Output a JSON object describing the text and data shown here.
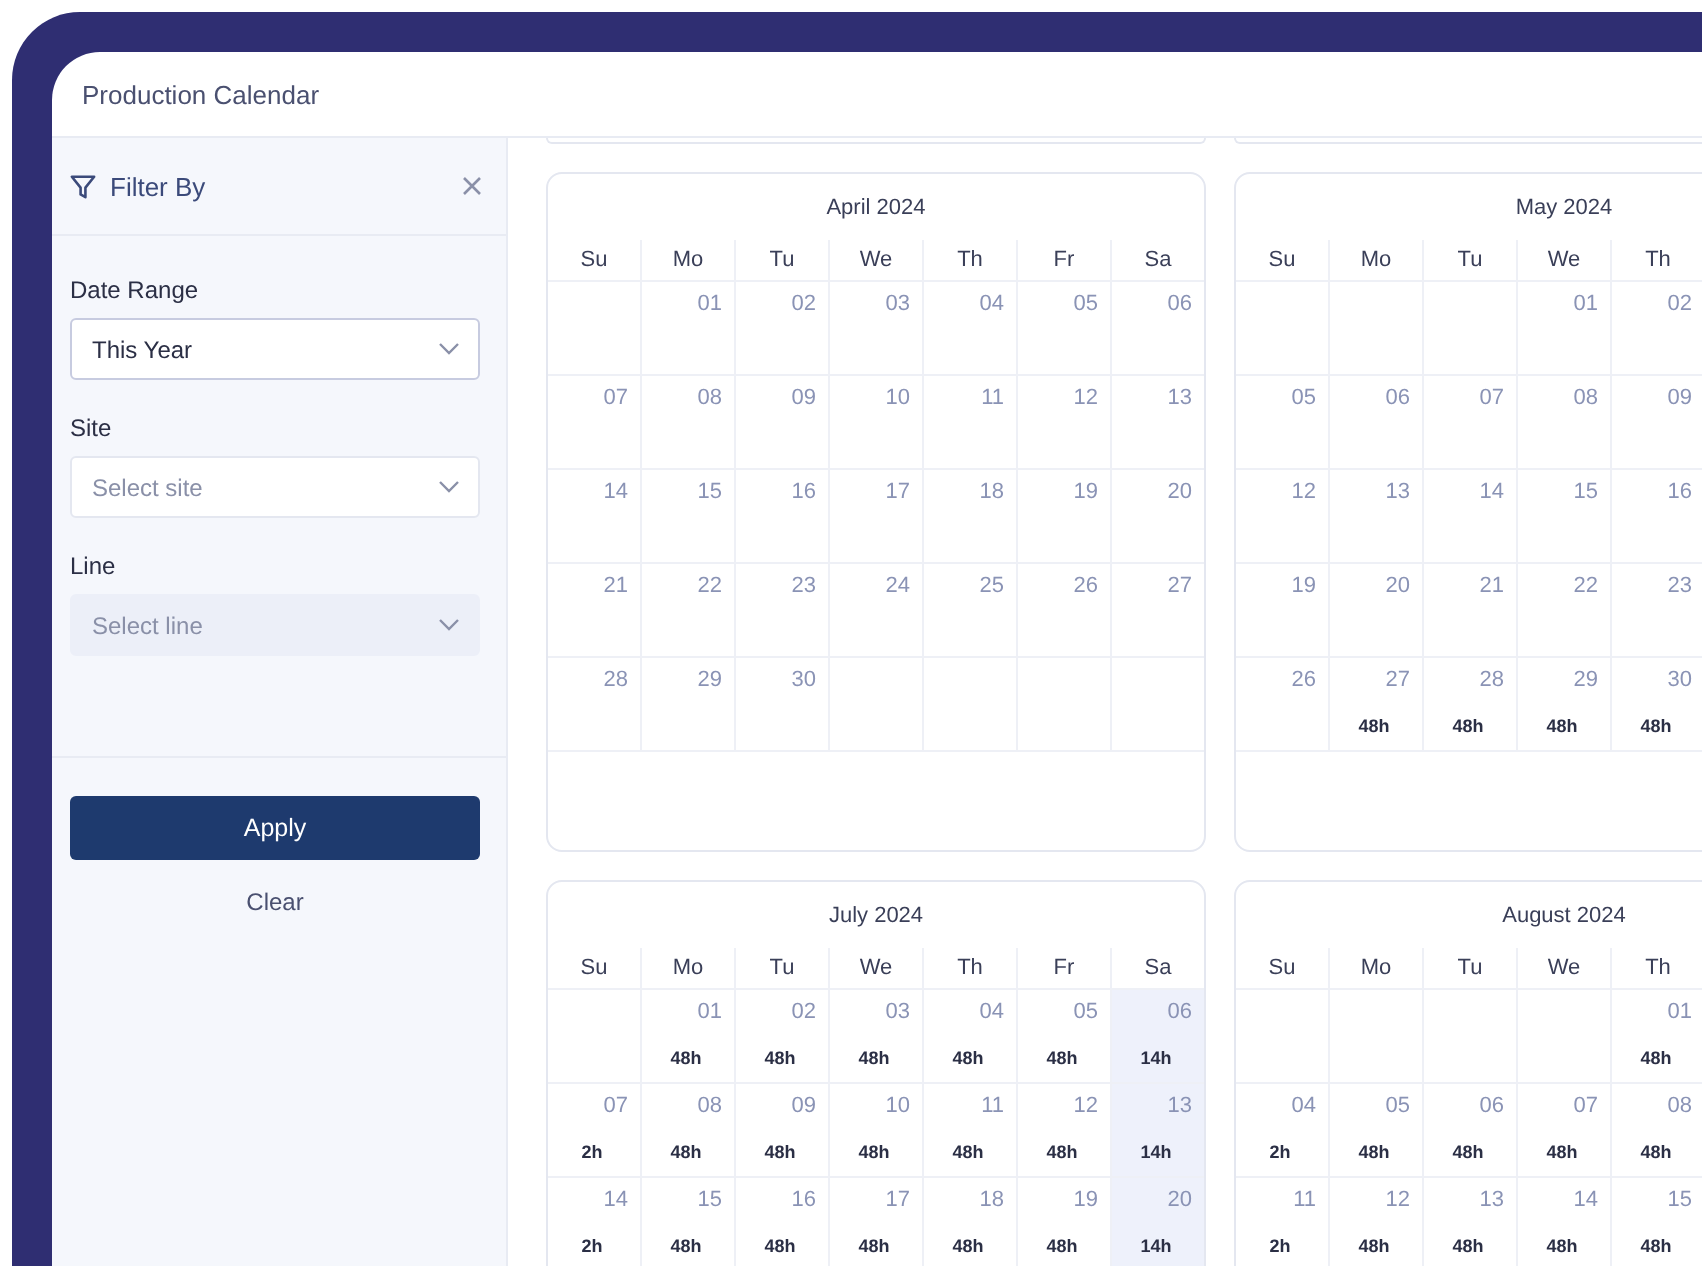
{
  "window": {
    "title": "Production Calendar"
  },
  "filter": {
    "title": "Filter By",
    "fields": [
      {
        "label": "Date Range",
        "value": "This Year",
        "disabled": false
      },
      {
        "label": "Site",
        "placeholder": "Select site",
        "disabled": false
      },
      {
        "label": "Line",
        "placeholder": "Select line",
        "disabled": true
      }
    ],
    "apply": "Apply",
    "clear": "Clear"
  },
  "calendars": [
    {
      "title": "April 2024",
      "weekdays": [
        "Su",
        "Mo",
        "Tu",
        "We",
        "Th",
        "Fr",
        "Sa"
      ],
      "weeks": [
        [
          {
            "day": "01",
            "highlighted": false
          },
          {
            "day": "02",
            "highlighted": false
          },
          {
            "day": "03",
            "highlighted": false
          },
          {
            "day": "04",
            "highlighted": false
          },
          {
            "day": "05",
            "highlighted": false
          },
          {
            "day": "06",
            "highlighted": false
          }
        ],
        [
          {
            "day": "07",
            "highlighted": false
          },
          {
            "day": "08",
            "highlighted": false
          },
          {
            "day": "09",
            "highlighted": false
          },
          {
            "day": "10",
            "highlighted": false
          },
          {
            "day": "11",
            "highlighted": false
          },
          {
            "day": "12",
            "highlighted": false
          },
          {
            "day": "13",
            "highlighted": false
          }
        ],
        [
          {
            "day": "14",
            "highlighted": false
          },
          {
            "day": "15",
            "highlighted": false
          },
          {
            "day": "16",
            "highlighted": false
          },
          {
            "day": "17",
            "highlighted": false
          },
          {
            "day": "18",
            "highlighted": false
          },
          {
            "day": "19",
            "highlighted": false
          },
          {
            "day": "20",
            "highlighted": false
          }
        ],
        [
          {
            "day": "21",
            "highlighted": false
          },
          {
            "day": "22",
            "highlighted": false
          },
          {
            "day": "23",
            "highlighted": false
          },
          {
            "day": "24",
            "highlighted": false
          },
          {
            "day": "25",
            "highlighted": false
          },
          {
            "day": "26",
            "highlighted": false
          },
          {
            "day": "27",
            "highlighted": false
          }
        ],
        [
          {
            "day": "28",
            "highlighted": false
          },
          {
            "day": "29",
            "highlighted": false
          },
          {
            "day": "30",
            "highlighted": false
          }
        ]
      ]
    },
    {
      "title": "May 2024",
      "weekdays": [
        "Su",
        "Mo",
        "Tu",
        "We",
        "Th"
      ],
      "weeks": [
        [
          {
            "day": "01",
            "highlighted": false
          },
          {
            "day": "02",
            "highlighted": false
          }
        ],
        [
          {
            "day": "05",
            "highlighted": false
          },
          {
            "day": "06",
            "highlighted": false
          },
          {
            "day": "07",
            "highlighted": false
          },
          {
            "day": "08",
            "highlighted": false
          },
          {
            "day": "09",
            "highlighted": false
          }
        ],
        [
          {
            "day": "12",
            "highlighted": false
          },
          {
            "day": "13",
            "highlighted": false
          },
          {
            "day": "14",
            "highlighted": false
          },
          {
            "day": "15",
            "highlighted": false
          },
          {
            "day": "16",
            "highlighted": false
          }
        ],
        [
          {
            "day": "19",
            "highlighted": false
          },
          {
            "day": "20",
            "highlighted": false
          },
          {
            "day": "21",
            "highlighted": false
          },
          {
            "day": "22",
            "highlighted": false
          },
          {
            "day": "23",
            "highlighted": false
          }
        ],
        [
          {
            "day": "26",
            "highlighted": false
          },
          {
            "day": "27",
            "hours": "48h",
            "highlighted": false
          },
          {
            "day": "28",
            "hours": "48h",
            "highlighted": false
          },
          {
            "day": "29",
            "hours": "48h",
            "highlighted": false
          },
          {
            "day": "30",
            "hours": "48h",
            "highlighted": false
          }
        ]
      ]
    },
    {
      "title": "July 2024",
      "weekdays": [
        "Su",
        "Mo",
        "Tu",
        "We",
        "Th",
        "Fr",
        "Sa"
      ],
      "weeks": [
        [
          {
            "day": "01",
            "hours": "48h",
            "highlighted": false
          },
          {
            "day": "02",
            "hours": "48h",
            "highlighted": false
          },
          {
            "day": "03",
            "hours": "48h",
            "highlighted": false
          },
          {
            "day": "04",
            "hours": "48h",
            "highlighted": false
          },
          {
            "day": "05",
            "hours": "48h",
            "highlighted": false
          },
          {
            "day": "06",
            "hours": "14h",
            "highlighted": true
          }
        ],
        [
          {
            "day": "07",
            "hours": "2h",
            "highlighted": false
          },
          {
            "day": "08",
            "hours": "48h",
            "highlighted": false
          },
          {
            "day": "09",
            "hours": "48h",
            "highlighted": false
          },
          {
            "day": "10",
            "hours": "48h",
            "highlighted": false
          },
          {
            "day": "11",
            "hours": "48h",
            "highlighted": false
          },
          {
            "day": "12",
            "hours": "48h",
            "highlighted": false
          },
          {
            "day": "13",
            "hours": "14h",
            "highlighted": true
          }
        ],
        [
          {
            "day": "14",
            "hours": "2h",
            "highlighted": false
          },
          {
            "day": "15",
            "hours": "48h",
            "highlighted": false
          },
          {
            "day": "16",
            "hours": "48h",
            "highlighted": false
          },
          {
            "day": "17",
            "hours": "48h",
            "highlighted": false
          },
          {
            "day": "18",
            "hours": "48h",
            "highlighted": false
          },
          {
            "day": "19",
            "hours": "48h",
            "highlighted": false
          },
          {
            "day": "20",
            "hours": "14h",
            "highlighted": true
          }
        ]
      ]
    },
    {
      "title": "August 2024",
      "weekdays": [
        "Su",
        "Mo",
        "Tu",
        "We",
        "Th"
      ],
      "weeks": [
        [
          {
            "day": "01",
            "hours": "48h",
            "highlighted": false
          }
        ],
        [
          {
            "day": "04",
            "hours": "2h",
            "highlighted": false
          },
          {
            "day": "05",
            "hours": "48h",
            "highlighted": false
          },
          {
            "day": "06",
            "hours": "48h",
            "highlighted": false
          },
          {
            "day": "07",
            "hours": "48h",
            "highlighted": false
          },
          {
            "day": "08",
            "hours": "48h",
            "highlighted": false
          }
        ],
        [
          {
            "day": "11",
            "hours": "2h",
            "highlighted": false
          },
          {
            "day": "12",
            "hours": "48h",
            "highlighted": false
          },
          {
            "day": "13",
            "hours": "48h",
            "highlighted": false
          },
          {
            "day": "14",
            "hours": "48h",
            "highlighted": false
          },
          {
            "day": "15",
            "hours": "48h",
            "highlighted": false
          }
        ]
      ]
    }
  ]
}
